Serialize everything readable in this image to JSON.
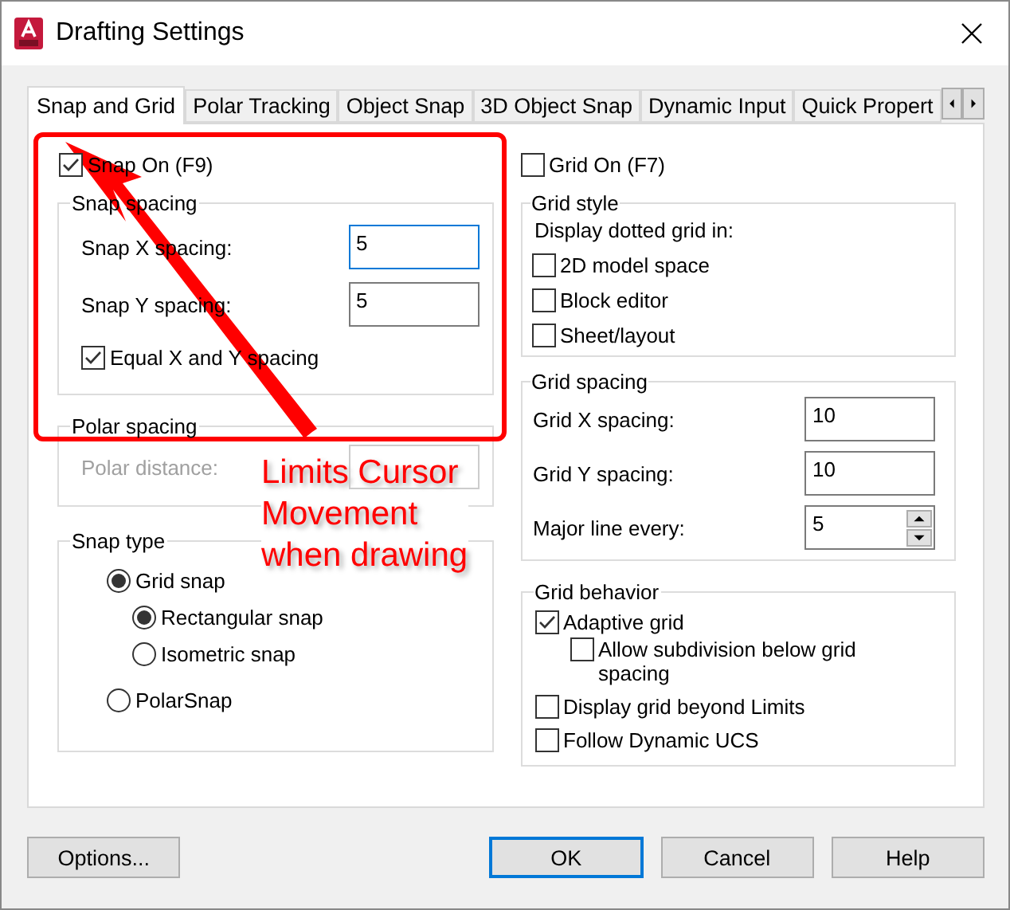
{
  "window": {
    "title": "Drafting Settings"
  },
  "tabs": [
    {
      "label": "Snap and Grid",
      "selected": true
    },
    {
      "label": "Polar Tracking",
      "selected": false
    },
    {
      "label": "Object Snap",
      "selected": false
    },
    {
      "label": "3D Object Snap",
      "selected": false
    },
    {
      "label": "Dynamic Input",
      "selected": false
    },
    {
      "label": "Quick Propert",
      "selected": false
    }
  ],
  "snap_on": {
    "label": "Snap On (F9)",
    "checked": true
  },
  "snap_spacing": {
    "title": "Snap spacing",
    "fields": [
      {
        "label": "Snap X spacing:",
        "value": "5",
        "focused": true
      },
      {
        "label": "Snap Y spacing:",
        "value": "5",
        "focused": false
      }
    ],
    "equal": {
      "label": "Equal X and Y spacing",
      "checked": true
    }
  },
  "polar_spacing": {
    "title": "Polar spacing",
    "field": {
      "label": "Polar distance:",
      "disabled": true
    }
  },
  "snap_type": {
    "title": "Snap type",
    "options": [
      {
        "label": "Grid snap",
        "selected": true,
        "children": [
          {
            "label": "Rectangular snap",
            "selected": true
          },
          {
            "label": "Isometric snap",
            "selected": false
          }
        ]
      },
      {
        "label": "PolarSnap",
        "selected": false
      }
    ]
  },
  "grid_on": {
    "label": "Grid On (F7)",
    "checked": false
  },
  "grid_style": {
    "title": "Grid style",
    "caption": "Display dotted grid in:",
    "options": [
      {
        "label": "2D model space",
        "checked": false
      },
      {
        "label": "Block editor",
        "checked": false
      },
      {
        "label": "Sheet/layout",
        "checked": false
      }
    ]
  },
  "grid_spacing": {
    "title": "Grid spacing",
    "fields": [
      {
        "label": "Grid X spacing:",
        "value": "10",
        "kind": "text"
      },
      {
        "label": "Grid Y spacing:",
        "value": "10",
        "kind": "text"
      },
      {
        "label": "Major line every:",
        "value": "5",
        "kind": "spinner"
      }
    ]
  },
  "grid_behavior": {
    "title": "Grid behavior",
    "options": [
      {
        "label": "Adaptive grid",
        "checked": true,
        "children": [
          {
            "label": "Allow subdivision below grid spacing",
            "checked": false
          }
        ]
      },
      {
        "label": "Display grid beyond Limits",
        "checked": false
      },
      {
        "label": "Follow Dynamic UCS",
        "checked": false
      }
    ]
  },
  "buttons": [
    {
      "label": "Options...",
      "kind": "normal"
    },
    {
      "label": "OK",
      "kind": "default"
    },
    {
      "label": "Cancel",
      "kind": "normal"
    },
    {
      "label": "Help",
      "kind": "normal"
    }
  ],
  "annotation": {
    "lines": [
      "Limits Cursor",
      "Movement",
      "when drawing"
    ]
  }
}
